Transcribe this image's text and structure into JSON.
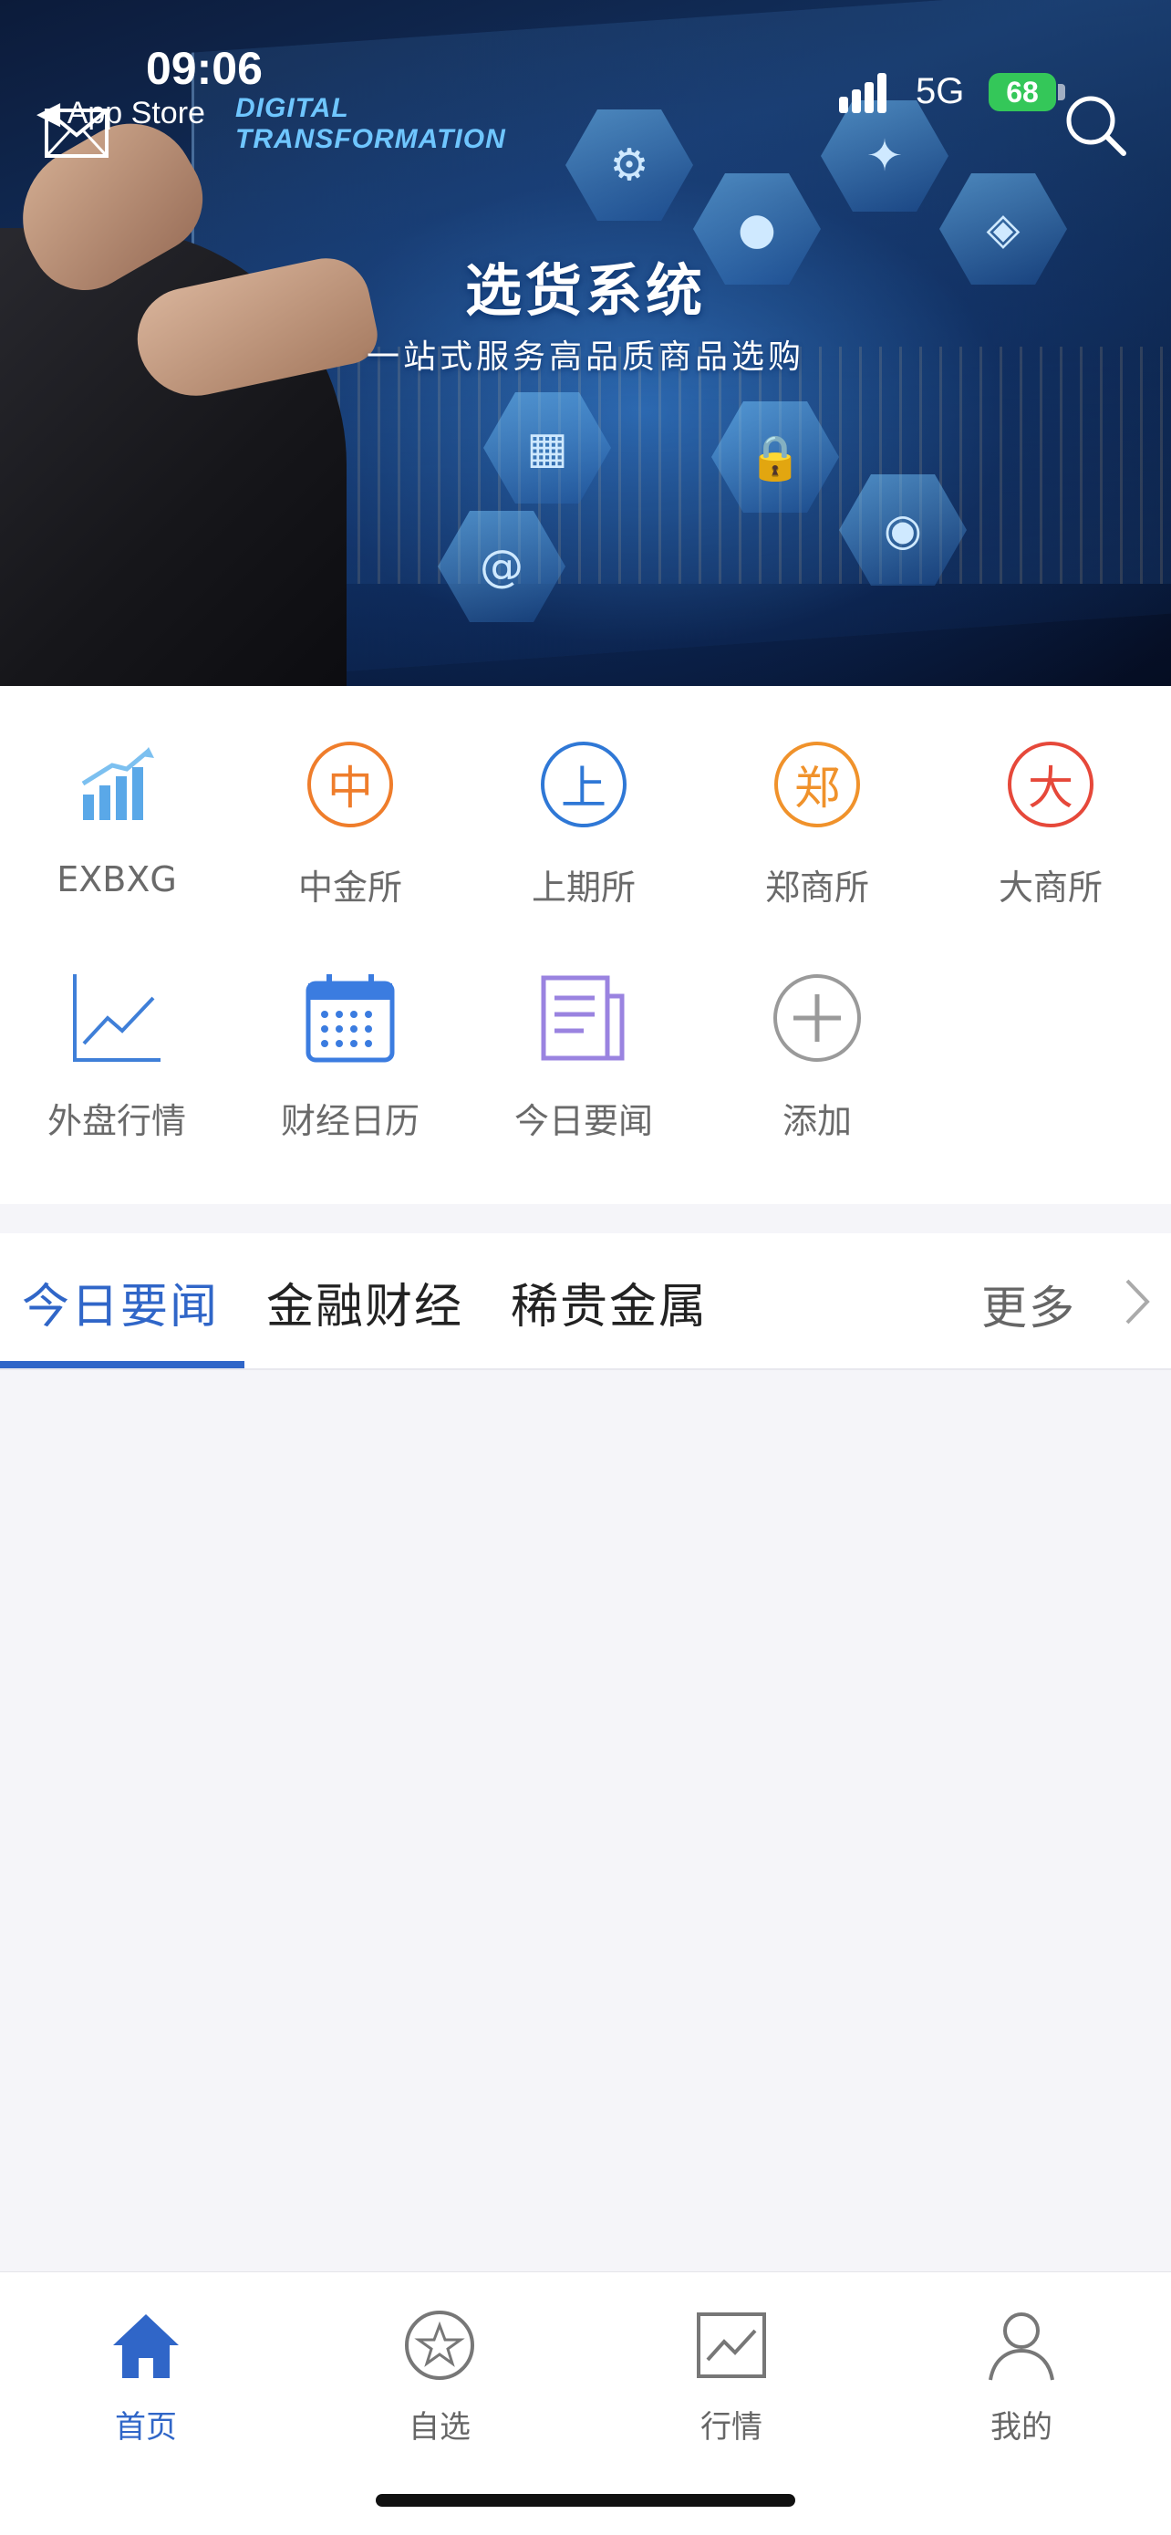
{
  "status_bar": {
    "time": "09:06",
    "back_app": "◀ App Store",
    "network": "5G",
    "battery": "68"
  },
  "banner": {
    "tag_line1": "DIGITAL",
    "tag_line2": "TRANSFORMATION",
    "title": "选货系统",
    "subtitle": "一站式服务高品质商品选购"
  },
  "quick_access": [
    {
      "label": "EXBXG",
      "icon": "bar-chart-icon",
      "glyph": "",
      "color": "#5aa8e8"
    },
    {
      "label": "中金所",
      "icon": "zhong-badge-icon",
      "glyph": "中",
      "color": "#ef7d2b"
    },
    {
      "label": "上期所",
      "icon": "shang-badge-icon",
      "glyph": "上",
      "color": "#2f78d6"
    },
    {
      "label": "郑商所",
      "icon": "zheng-badge-icon",
      "glyph": "郑",
      "color": "#f0922b"
    },
    {
      "label": "大商所",
      "icon": "da-badge-icon",
      "glyph": "大",
      "color": "#e6483a"
    },
    {
      "label": "外盘行情",
      "icon": "line-chart-icon",
      "glyph": "",
      "color": "#3f7fd8"
    },
    {
      "label": "财经日历",
      "icon": "calendar-icon",
      "glyph": "",
      "color": "#3b7ce0"
    },
    {
      "label": "今日要闻",
      "icon": "news-icon",
      "glyph": "",
      "color": "#9a83e0"
    },
    {
      "label": "添加",
      "icon": "add-icon",
      "glyph": "",
      "color": "#9a9a9a"
    }
  ],
  "news_tabs": {
    "tabs": [
      "今日要闻",
      "金融财经",
      "稀贵金属"
    ],
    "active_index": 0,
    "more_label": "更多"
  },
  "bottom_nav": [
    {
      "label": "首页",
      "icon": "home-icon",
      "active": true
    },
    {
      "label": "自选",
      "icon": "star-circle-icon",
      "active": false
    },
    {
      "label": "行情",
      "icon": "chart-box-icon",
      "active": false
    },
    {
      "label": "我的",
      "icon": "user-icon",
      "active": false
    }
  ],
  "colors": {
    "accent": "#3066c8",
    "background": "#f5f5f9"
  }
}
